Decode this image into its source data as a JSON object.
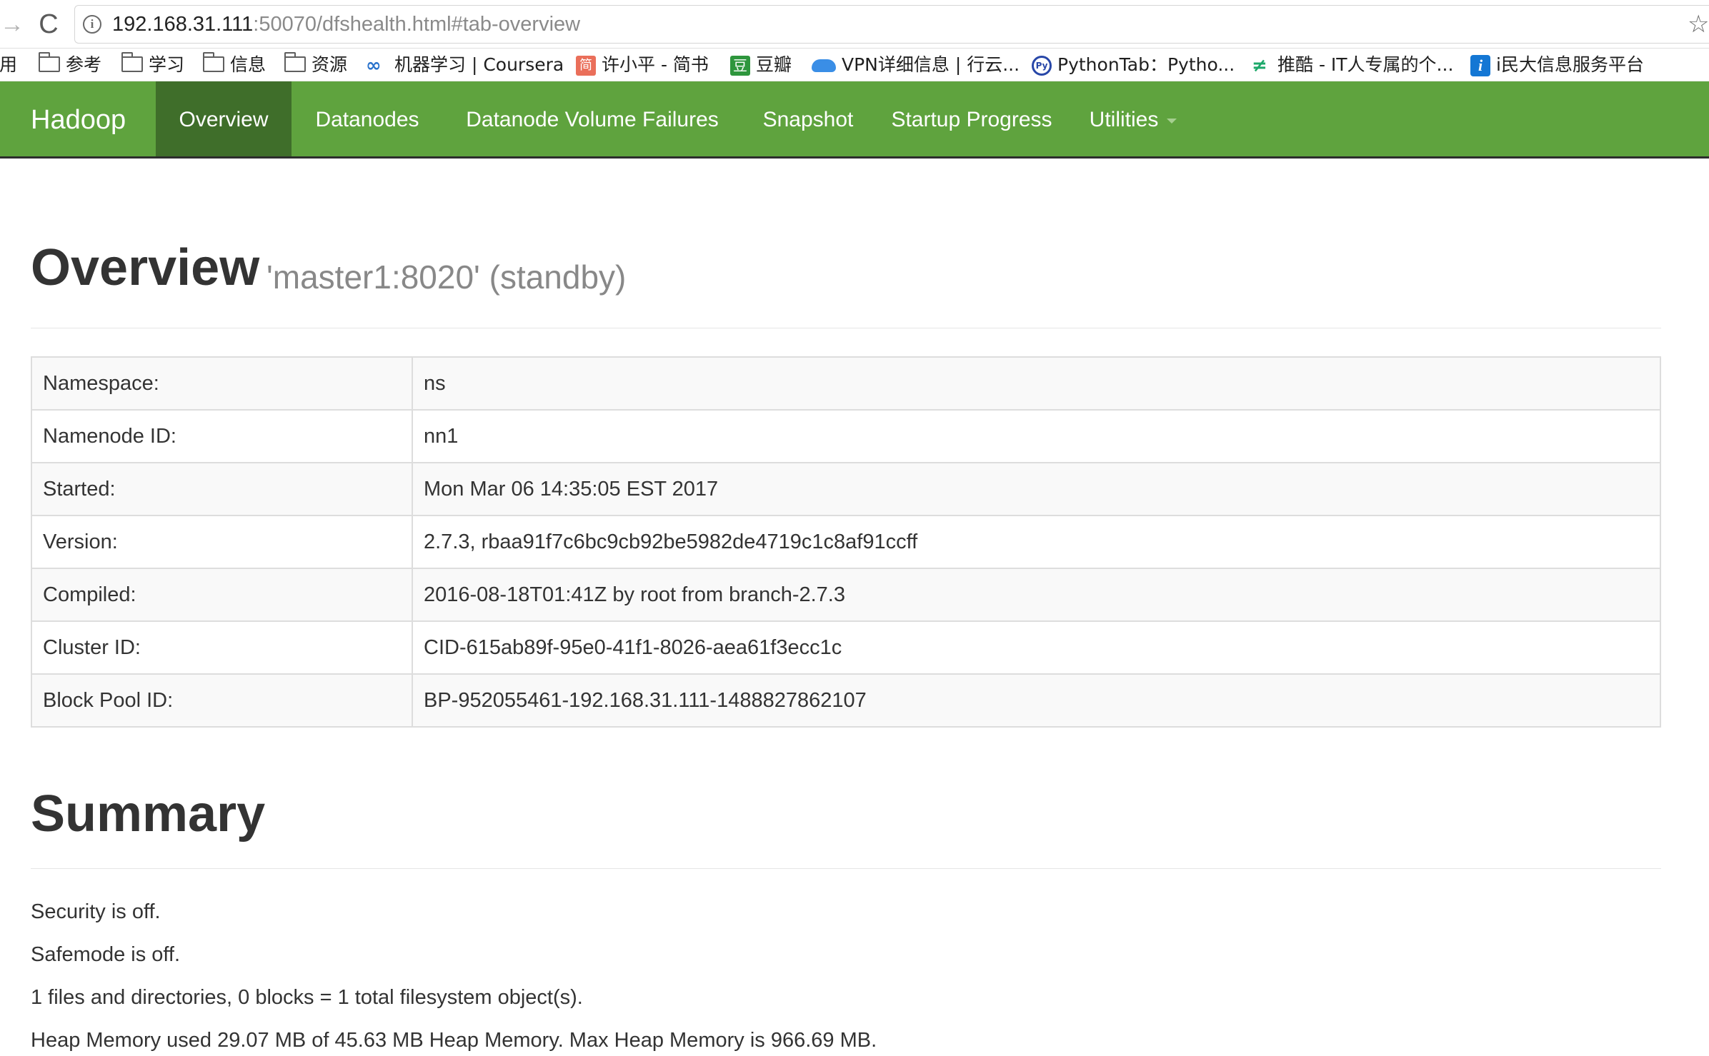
{
  "browser": {
    "url_host": "192.168.31.111",
    "url_rest": ":50070/dfshealth.html#tab-overview",
    "back_icon": "→",
    "reload_icon": "C",
    "star_icon": "☆"
  },
  "bookmarks": [
    {
      "label": "应用",
      "icon": "apps-icon"
    },
    {
      "label": "参考",
      "icon": "folder-icon"
    },
    {
      "label": "学习",
      "icon": "folder-icon"
    },
    {
      "label": "信息",
      "icon": "folder-icon"
    },
    {
      "label": "资源",
      "icon": "folder-icon"
    },
    {
      "label": "机器学习 | Coursera",
      "icon": "coursera-icon"
    },
    {
      "label": "许小平 - 简书",
      "icon": "jianshu-icon"
    },
    {
      "label": "豆瓣",
      "icon": "douban-icon"
    },
    {
      "label": "VPN详细信息 | 行云...",
      "icon": "cloud-icon"
    },
    {
      "label": "PythonTab：Pytho...",
      "icon": "pythontab-icon"
    },
    {
      "label": "推酷 - IT人专属的个...",
      "icon": "tuicool-icon"
    },
    {
      "label": "i民大信息服务平台",
      "icon": "info-icon"
    }
  ],
  "navbar": {
    "brand": "Hadoop",
    "items": [
      "Overview",
      "Datanodes",
      "Datanode Volume Failures",
      "Snapshot",
      "Startup Progress",
      "Utilities"
    ],
    "active": "Overview",
    "color": "#5fa33e",
    "active_color": "#3f6e2a"
  },
  "overview": {
    "title": "Overview",
    "subtitle": "'master1:8020' (standby)",
    "rows": [
      {
        "key": "Namespace:",
        "value": "ns"
      },
      {
        "key": "Namenode ID:",
        "value": "nn1"
      },
      {
        "key": "Started:",
        "value": "Mon Mar 06 14:35:05 EST 2017"
      },
      {
        "key": "Version:",
        "value": "2.7.3, rbaa91f7c6bc9cb92be5982de4719c1c8af91ccff"
      },
      {
        "key": "Compiled:",
        "value": "2016-08-18T01:41Z by root from branch-2.7.3"
      },
      {
        "key": "Cluster ID:",
        "value": "CID-615ab89f-95e0-41f1-8026-aea61f3ecc1c"
      },
      {
        "key": "Block Pool ID:",
        "value": "BP-952055461-192.168.31.111-1488827862107"
      }
    ]
  },
  "summary": {
    "title": "Summary",
    "lines": [
      "Security is off.",
      "Safemode is off.",
      "1 files and directories, 0 blocks = 1 total filesystem object(s).",
      "Heap Memory used 29.07 MB of 45.63 MB Heap Memory. Max Heap Memory is 966.69 MB."
    ]
  }
}
